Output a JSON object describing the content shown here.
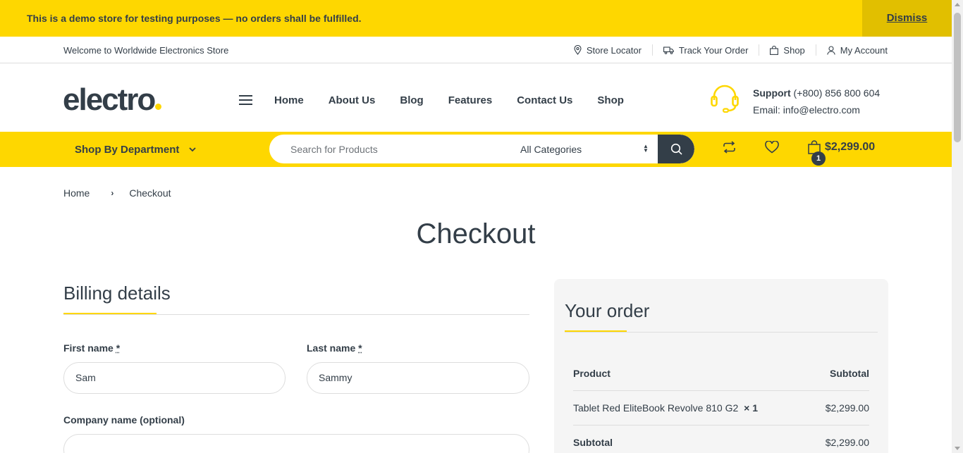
{
  "demo_notice": {
    "text": "This is a demo store for testing purposes — no orders shall be fulfilled.",
    "dismiss_label": "Dismiss"
  },
  "topbar": {
    "welcome": "Welcome to Worldwide Electronics Store",
    "links": [
      {
        "label": "Store Locator",
        "icon": "map-pin-icon"
      },
      {
        "label": "Track Your Order",
        "icon": "truck-icon"
      },
      {
        "label": "Shop",
        "icon": "shopping-bag-icon"
      },
      {
        "label": "My Account",
        "icon": "user-icon"
      }
    ]
  },
  "header": {
    "logo": "electro",
    "nav": [
      "Home",
      "About Us",
      "Blog",
      "Features",
      "Contact Us",
      "Shop"
    ],
    "support_label": "Support",
    "support_phone": "(+800) 856 800 604",
    "support_email": "Email: info@electro.com"
  },
  "navbar": {
    "department_label": "Shop By Department",
    "search_placeholder": "Search for Products",
    "category_selected": "All Categories",
    "cart_total": "$2,299.00",
    "cart_count": "1"
  },
  "breadcrumb": {
    "home": "Home",
    "current": "Checkout"
  },
  "page_title": "Checkout",
  "billing": {
    "title": "Billing details",
    "first_name_label": "First name",
    "last_name_label": "Last name",
    "required_mark": "*",
    "first_name_value": "Sam",
    "last_name_value": "Sammy",
    "company_label": "Company name (optional)",
    "company_value": ""
  },
  "order": {
    "title": "Your order",
    "col_product": "Product",
    "col_subtotal": "Subtotal",
    "item_name": "Tablet Red EliteBook Revolve 810 G2",
    "item_qty": "× 1",
    "item_price": "$2,299.00",
    "subtotal_label": "Subtotal",
    "subtotal_value": "$2,299.00"
  },
  "colors": {
    "accent": "#fed700",
    "dark": "#333e48"
  }
}
